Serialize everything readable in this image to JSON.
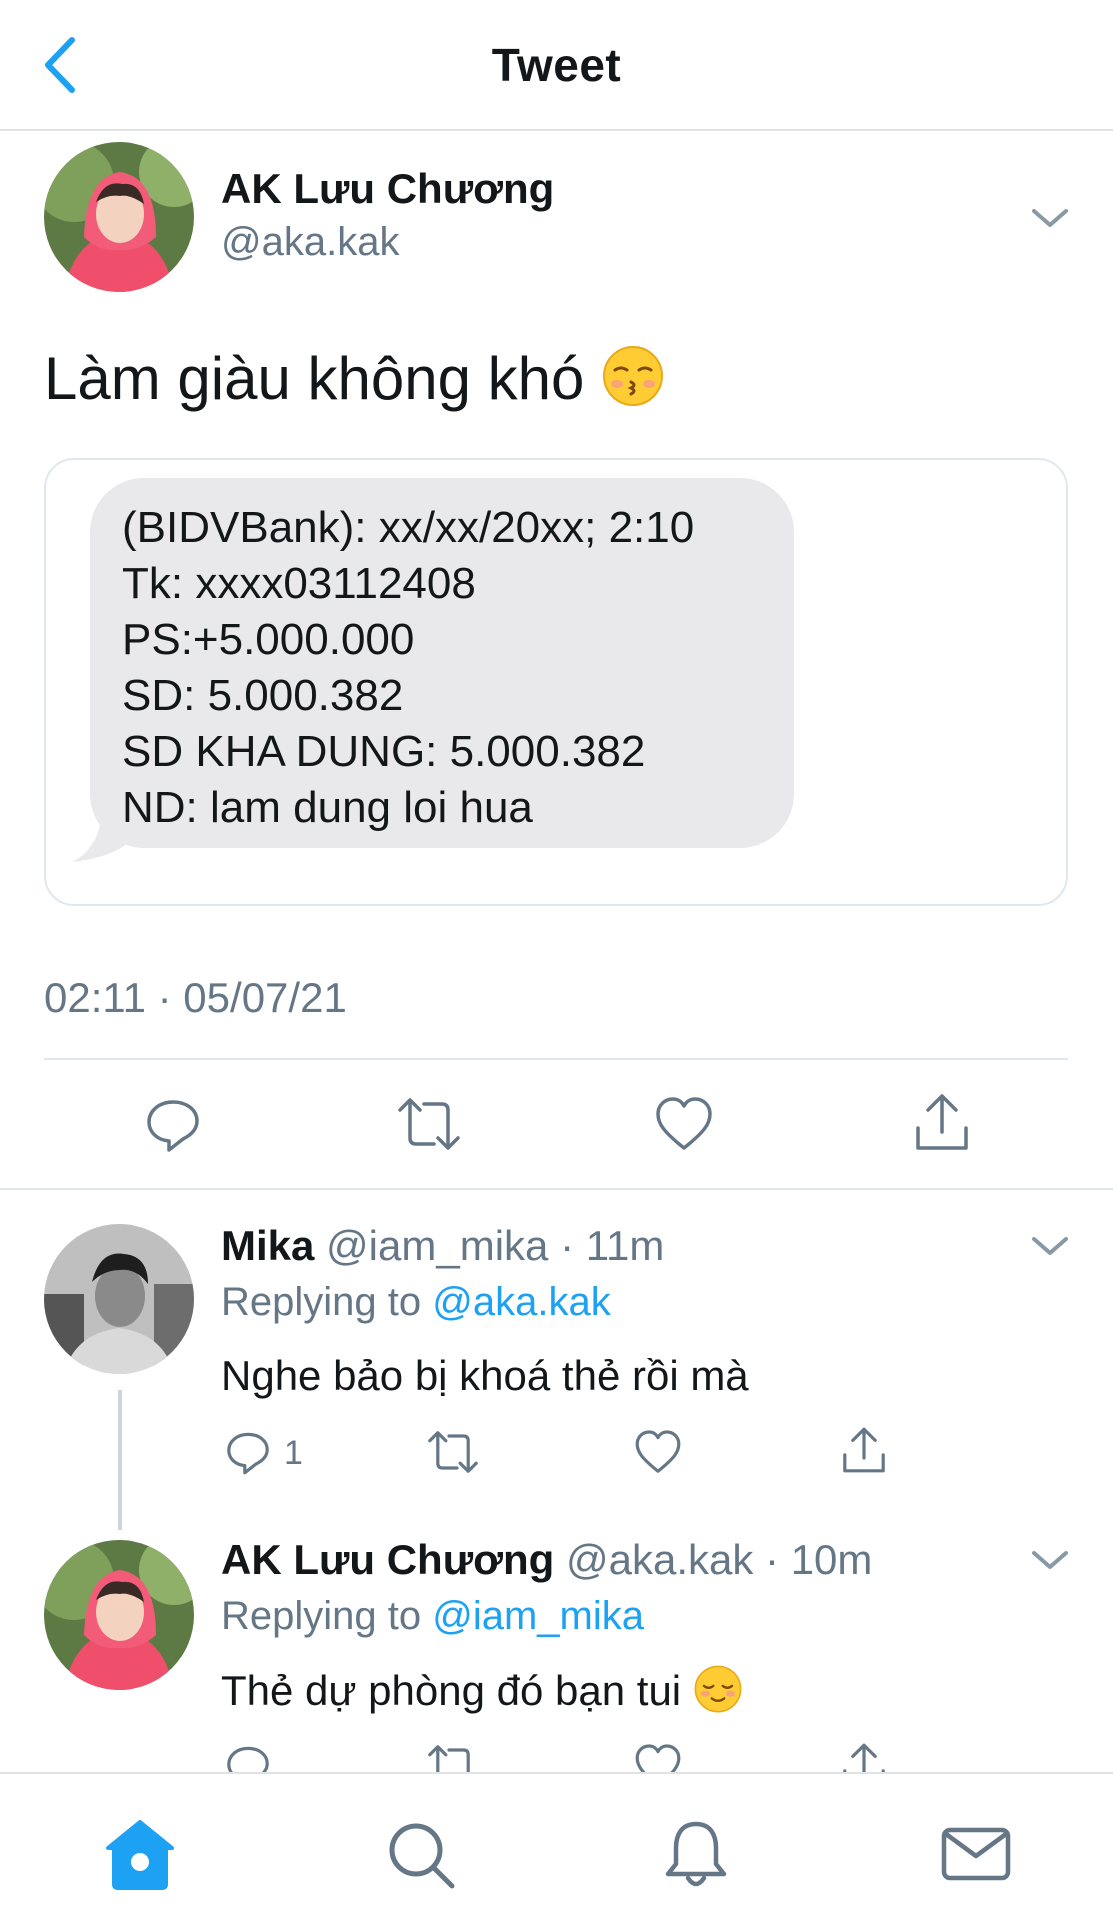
{
  "header": {
    "title": "Tweet"
  },
  "tweet": {
    "author_name": "AK Lưu Chương",
    "author_handle": "@aka.kak",
    "text": "Làm giàu không khó",
    "emoji": "kissing-face-closed-eyes",
    "sms_lines": [
      "(BIDVBank): xx/xx/20xx; 2:10",
      "Tk: xxxx03112408",
      "PS:+5.000.000",
      "SD: 5.000.382",
      "SD KHA DUNG: 5.000.382",
      "ND: lam dung loi hua"
    ],
    "timestamp": "02:11 · 05/07/21"
  },
  "replies": [
    {
      "name": "Mika",
      "handle": "@iam_mika",
      "time": "11m",
      "replying_label": "Replying to",
      "replying_to": "@aka.kak",
      "text": "Nghe bảo bị khoá thẻ rồi mà",
      "reply_count": "1"
    },
    {
      "name": "AK Lưu Chương",
      "handle": "@aka.kak",
      "time": "10m",
      "replying_label": "Replying to",
      "replying_to": "@iam_mika",
      "text": "Thẻ dự phòng đó bạn tui",
      "emoji": "relieved-face"
    }
  ],
  "tabbar": {
    "items": [
      "home",
      "search",
      "notifications",
      "messages"
    ],
    "active": "home"
  },
  "colors": {
    "accent": "#1da1f2",
    "secondary_text": "#657786",
    "bubble": "#e9e9eb"
  }
}
